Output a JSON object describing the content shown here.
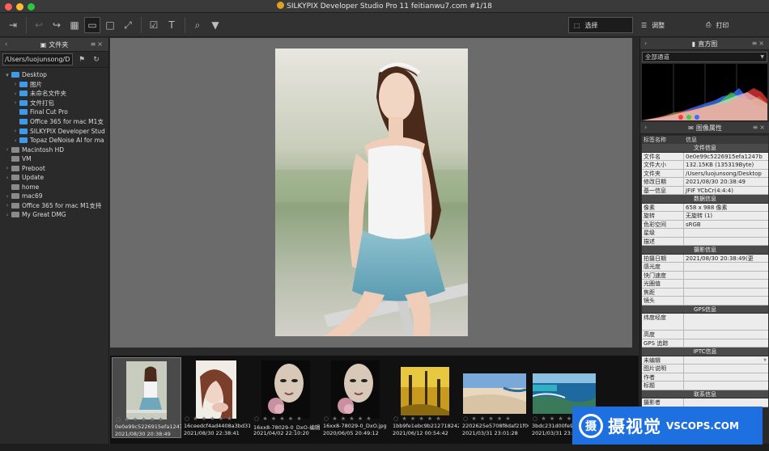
{
  "window": {
    "title": "SILKYPIX Developer Studio Pro 11 feitianwu7.com   #1/18"
  },
  "toolbar": {
    "icons": [
      "import-icon",
      "undo-icon",
      "redo-icon",
      "grid-icon",
      "single-view-icon",
      "compare-icon",
      "fullscreen-icon",
      "check-icon",
      "text-icon",
      "search-icon",
      "filter-icon"
    ],
    "modes": {
      "select": "选择",
      "adjust": "调整",
      "print": "打印"
    }
  },
  "folder_panel": {
    "title": "文件夹",
    "path": "/Users/luojunsong/D...",
    "tree": [
      {
        "label": "Desktop",
        "level": 0,
        "arrow": "▾",
        "color": "blue"
      },
      {
        "label": "图片",
        "level": 1,
        "arrow": "›",
        "color": "blue"
      },
      {
        "label": "未命名文件夹",
        "level": 1,
        "arrow": "›",
        "color": "blue"
      },
      {
        "label": "文件打包",
        "level": 1,
        "arrow": "›",
        "color": "blue"
      },
      {
        "label": "Final Cut Pro",
        "level": 1,
        "arrow": "",
        "color": "blue"
      },
      {
        "label": "Office 365 for mac M1支",
        "level": 1,
        "arrow": "",
        "color": "blue"
      },
      {
        "label": "SILKYPIX Developer Stud",
        "level": 1,
        "arrow": "›",
        "color": "blue"
      },
      {
        "label": "Topaz DeNoise AI for ma",
        "level": 1,
        "arrow": "›",
        "color": "blue"
      },
      {
        "label": "Macintosh HD",
        "level": 0,
        "arrow": "›",
        "color": "gray"
      },
      {
        "label": "VM",
        "level": 0,
        "arrow": "",
        "color": "gray"
      },
      {
        "label": "Preboot",
        "level": 0,
        "arrow": "›",
        "color": "gray"
      },
      {
        "label": "Update",
        "level": 0,
        "arrow": "›",
        "color": "gray"
      },
      {
        "label": "home",
        "level": 0,
        "arrow": "",
        "color": "gray"
      },
      {
        "label": "mac69",
        "level": 0,
        "arrow": "›",
        "color": "gray"
      },
      {
        "label": "Office 365 for mac M1支持",
        "level": 0,
        "arrow": "›",
        "color": "gray"
      },
      {
        "label": "My Great DMG",
        "level": 0,
        "arrow": "›",
        "color": "gray"
      }
    ]
  },
  "filmstrip": [
    {
      "name": "0e0e99c5226915efa1247b3",
      "date": "2021/08/30 20:38:49",
      "selected": true,
      "kind": "girl"
    },
    {
      "name": "16ceedcf4ad4408a3bd3163",
      "date": "2021/08/30 22:38:41",
      "selected": false,
      "kind": "portrait"
    },
    {
      "name": "16xx8-78029-0_DxO-编辑.j",
      "date": "2021/04/02 22:10:20",
      "selected": false,
      "kind": "face"
    },
    {
      "name": "16xx8-78029-0_DxO.jpg",
      "date": "2020/06/05 20:49:12",
      "selected": false,
      "kind": "face"
    },
    {
      "name": "1bb9fe1ebc9b212718242169",
      "date": "2021/06/12 00:54:42",
      "selected": false,
      "kind": "forest"
    },
    {
      "name": "2202625e5708f8daf21f066",
      "date": "2021/03/31 23:01:28",
      "selected": false,
      "kind": "dune"
    },
    {
      "name": "3bdc231d00fe969",
      "date": "2021/03/31 23:54:42",
      "selected": false,
      "kind": "coast"
    }
  ],
  "histogram_panel": {
    "title": "直方图",
    "channel": "全部通道"
  },
  "properties_panel": {
    "title": "图像属性",
    "col_key": "标签名称",
    "col_val": "信息",
    "sections": [
      {
        "title": "文件信息",
        "rows": [
          {
            "k": "文件名",
            "v": "0e0e99c5226915efa1247b"
          },
          {
            "k": "文件大小",
            "v": "132.15KB (135319Byte)"
          },
          {
            "k": "文件夹",
            "v": "/Users/luojunsong/Desktop"
          },
          {
            "k": "修改日期",
            "v": "2021/08/30 20:38:49"
          },
          {
            "k": "基一信息",
            "v": "JFIF YCbCr(4:4:4)"
          }
        ]
      },
      {
        "title": "数据信息",
        "rows": [
          {
            "k": "像素",
            "v": "658 x 988 像素"
          },
          {
            "k": "旋转",
            "v": "无旋转 (1)"
          },
          {
            "k": "色彩空间",
            "v": "sRGB"
          },
          {
            "k": "星级",
            "v": ""
          },
          {
            "k": "描述",
            "v": ""
          }
        ]
      },
      {
        "title": "摄影信息",
        "rows": [
          {
            "k": "拍摄日期",
            "v": "2021/08/30 20:38:49(更"
          },
          {
            "k": "感光度",
            "v": ""
          },
          {
            "k": "快门速度",
            "v": ""
          },
          {
            "k": "光圈值",
            "v": ""
          },
          {
            "k": "焦距",
            "v": ""
          },
          {
            "k": "镜头",
            "v": ""
          }
        ]
      },
      {
        "title": "GPS信息",
        "rows": [
          {
            "k": "纬度经度",
            "v": "",
            "tall": true
          },
          {
            "k": "高度",
            "v": ""
          },
          {
            "k": "GPS 追踪",
            "v": ""
          }
        ]
      },
      {
        "title": "IPTC信息",
        "rows": [
          {
            "k": "未编辑",
            "v": "",
            "dd": true
          },
          {
            "k": "图片说明",
            "v": ""
          },
          {
            "k": "作者",
            "v": ""
          },
          {
            "k": "标题",
            "v": ""
          }
        ]
      },
      {
        "title": "联系信息",
        "rows": [
          {
            "k": "摄影者",
            "v": ""
          }
        ]
      }
    ]
  },
  "watermark": {
    "logo": "摄",
    "cn": "摄视觉",
    "en": "VSCOPS.COM"
  }
}
